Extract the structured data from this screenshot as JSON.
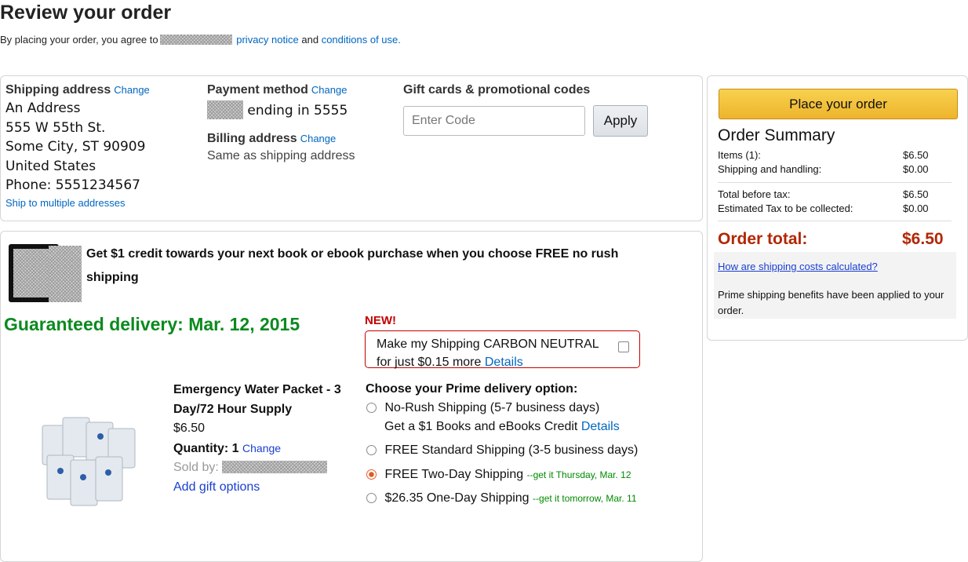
{
  "page": {
    "title": "Review your order",
    "agreement": {
      "prefix": "By placing your order, you agree to",
      "privacy_link": "privacy notice",
      "middle": "and",
      "conditions_link": "conditions of use."
    }
  },
  "shipping": {
    "heading": "Shipping address",
    "change": "Change",
    "lines": [
      "An Address",
      "555 W 55th St.",
      "Some City, ST 90909",
      "United States",
      "Phone: 5551234567"
    ],
    "multiple_link": "Ship to multiple addresses"
  },
  "payment": {
    "heading": "Payment method",
    "change": "Change",
    "card_text": "ending in 5555",
    "billing_heading": "Billing address",
    "billing_change": "Change",
    "billing_value": "Same as shipping address"
  },
  "gift": {
    "heading": "Gift cards & promotional codes",
    "placeholder": "Enter Code",
    "apply": "Apply"
  },
  "promo": {
    "text": "Get $1 credit towards your next book or ebook purchase when you choose FREE no rush shipping"
  },
  "delivery": {
    "guaranteed": "Guaranteed delivery: Mar. 12, 2015",
    "new_label": "NEW!",
    "carbon_text": "Make my Shipping CARBON NEUTRAL",
    "carbon_price": "for just $0.15 more",
    "carbon_details": "Details",
    "options_heading": "Choose your Prime delivery option:",
    "options": [
      {
        "label": "No-Rush Shipping (5-7 business days)",
        "sub": "Get a $1 Books and eBooks Credit",
        "details": "Details",
        "note": "",
        "selected": false
      },
      {
        "label": "FREE Standard Shipping (3-5 business days)",
        "note": "",
        "selected": false
      },
      {
        "label": "FREE Two-Day Shipping",
        "note": "--get it Thursday, Mar. 12",
        "selected": true
      },
      {
        "label": "$26.35 One-Day Shipping",
        "note": "--get it tomorrow, Mar. 11",
        "selected": false
      }
    ]
  },
  "item": {
    "name_line1": "Emergency Water Packet - 3",
    "name_line2": "Day/72 Hour Supply",
    "price": "$6.50",
    "quantity_label": "Quantity:",
    "quantity": "1",
    "change": "Change",
    "sold_by": "Sold by:",
    "gift_options": "Add gift options"
  },
  "summary": {
    "place_order": "Place your order",
    "heading": "Order Summary",
    "rows1": [
      {
        "label": "Items (1):",
        "value": "$6.50"
      },
      {
        "label": "Shipping and handling:",
        "value": "$0.00"
      }
    ],
    "rows2": [
      {
        "label": "Total before tax:",
        "value": "$6.50"
      },
      {
        "label": "Estimated Tax to be collected:",
        "value": "$0.00"
      }
    ],
    "total_label": "Order total:",
    "total_value": "$6.50",
    "shipping_link": "How are shipping costs calculated?",
    "prime_note": "Prime shipping benefits have been applied to your order."
  }
}
